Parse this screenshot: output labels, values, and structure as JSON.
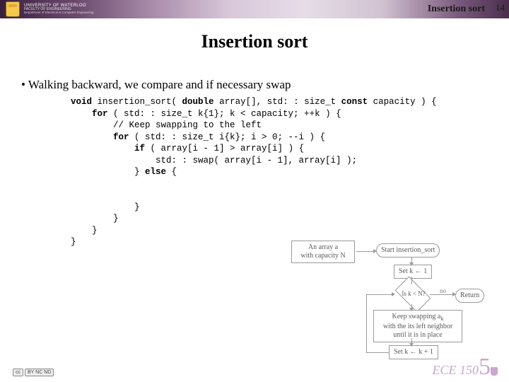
{
  "header": {
    "university": "UNIVERSITY OF WATERLOO",
    "faculty": "FACULTY OF ENGINEERING",
    "dept": "Department of Electrical & Computer Engineering",
    "breadcrumb": "Insertion sort",
    "pagenum": "14"
  },
  "title": "Insertion sort",
  "bullet": "Walking backward, we compare and if necessary swap",
  "code": {
    "l1a": "void",
    "l1b": " insertion_sort( ",
    "l1c": "double",
    "l1d": " array[], std: : size_t ",
    "l1e": "const",
    "l1f": " capacity ) {",
    "l2a": "    for",
    "l2b": " ( std: : size_t k{1}; k < capacity; ++k ) {",
    "l3": "        // Keep swapping to the left",
    "l4a": "        for",
    "l4b": " ( std: : size_t i{k}; i > 0; --i ) {",
    "l5a": "            if",
    "l5b": " ( array[i - 1] > array[i] ) {",
    "l6": "                std: : swap( array[i - 1], array[i] );",
    "l7a": "            } ",
    "l7b": "else",
    "l7c": " {",
    "l8": "",
    "l9": "            }",
    "l10": "        }",
    "l11": "    }",
    "l12": "}"
  },
  "diagram": {
    "n1a": "An array a",
    "n1b": "with capacity N",
    "n2": "Start insertion_sort",
    "n3": "Set k ← 1",
    "n4": "Is k < N?",
    "n4no": "no",
    "n4r": "Return",
    "n5a": "Keep swapping a",
    "n5b": "with the its left neighbor",
    "n5c": "until it is in place",
    "n6": "Set k ← k + 1"
  },
  "footer": {
    "cc": "cc",
    "by": "BY NC ND",
    "course": "ECE 150",
    "big": "5"
  }
}
